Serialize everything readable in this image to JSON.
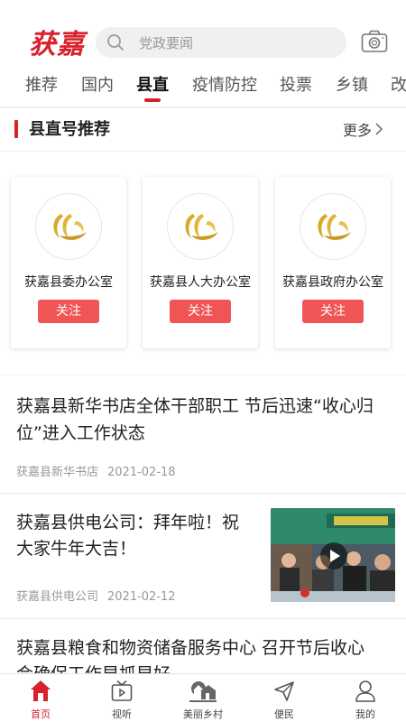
{
  "header": {
    "logo": "获嘉",
    "search_placeholder": "党政要闻"
  },
  "tabs": [
    {
      "label": "推荐"
    },
    {
      "label": "国内"
    },
    {
      "label": "县直",
      "active": true
    },
    {
      "label": "疫情防控"
    },
    {
      "label": "投票"
    },
    {
      "label": "乡镇"
    },
    {
      "label": "改"
    }
  ],
  "section": {
    "title": "县直号推荐",
    "more": "更多"
  },
  "cards": [
    {
      "name": "获嘉县委办公室",
      "button": "关注"
    },
    {
      "name": "获嘉县人大办公室",
      "button": "关注"
    },
    {
      "name": "获嘉县政府办公室",
      "button": "关注"
    }
  ],
  "articles": [
    {
      "title_line1": "获嘉县新华书店全体干部职工 节后迅速“收心归",
      "title_line2": "位”进入工作状态",
      "source": "获嘉县新华书店",
      "date": "2021-02-18"
    },
    {
      "title_line1": "获嘉县供电公司：拜年啦！祝",
      "title_line2": "大家牛年大吉！",
      "source": "获嘉县供电公司",
      "date": "2021-02-12",
      "has_video": true
    },
    {
      "title_line1": "获嘉县粮食和物资储备服务中心 召开节后收心",
      "title_line2": "会确保工作早抓早好"
    }
  ],
  "bottom_nav": [
    {
      "label": "首页",
      "icon": "home-icon",
      "active": true
    },
    {
      "label": "视听",
      "icon": "tv-icon"
    },
    {
      "label": "美丽乡村",
      "icon": "village-icon"
    },
    {
      "label": "便民",
      "icon": "send-icon"
    },
    {
      "label": "我的",
      "icon": "user-icon"
    }
  ],
  "colors": {
    "accent": "#d8212b",
    "follow_button": "#f05555"
  }
}
